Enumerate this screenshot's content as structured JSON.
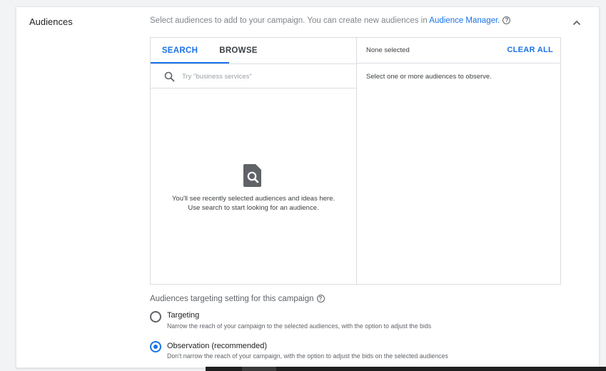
{
  "section": {
    "title": "Audiences",
    "intro_text": "Select audiences to add to your campaign. You can create new audiences in ",
    "intro_link": "Audience Manager.",
    "help_glyph": "?"
  },
  "tabs": [
    {
      "label": "SEARCH",
      "active": true
    },
    {
      "label": "BROWSE",
      "active": false
    }
  ],
  "search": {
    "placeholder": "Try \"business services\""
  },
  "empty_state": {
    "line1": "You'll see recently selected audiences and ideas here.",
    "line2": "Use search to start looking for an audience."
  },
  "selection": {
    "status": "None selected",
    "clear_label": "CLEAR ALL",
    "hint": "Select one or more audiences to observe."
  },
  "targeting": {
    "label": "Audiences targeting setting for this campaign",
    "options": [
      {
        "title": "Targeting",
        "description": "Narrow the reach of your campaign to the selected audiences, with the option to adjust the bids",
        "selected": false
      },
      {
        "title": "Observation (recommended)",
        "description": "Don't narrow the reach of your campaign, with the option to adjust the bids on the selected audiences",
        "selected": true
      }
    ]
  },
  "colors": {
    "accent": "#1a73e8",
    "text": "#3c4043",
    "muted": "#5f6368",
    "border": "#dadce0"
  }
}
